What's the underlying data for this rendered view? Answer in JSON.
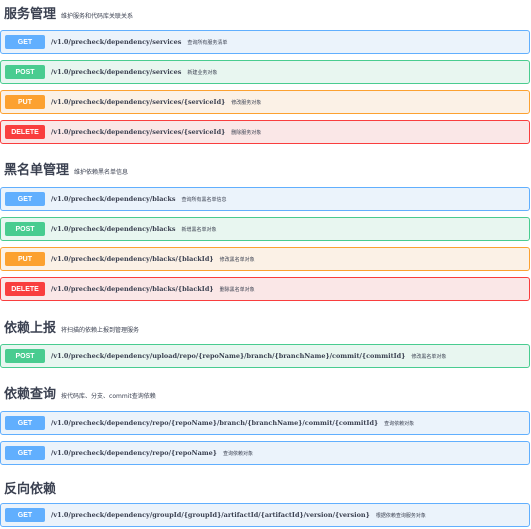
{
  "sections": [
    {
      "title": "服务管理",
      "description": "维护服务和代码库关联关系",
      "operations": [
        {
          "method": "GET",
          "path": "/v1.0/precheck/dependency/services",
          "summary": "查询所有服务清单"
        },
        {
          "method": "POST",
          "path": "/v1.0/precheck/dependency/services",
          "summary": "新建业务对象"
        },
        {
          "method": "PUT",
          "path": "/v1.0/precheck/dependency/services/{serviceId}",
          "summary": "修改服务对象"
        },
        {
          "method": "DELETE",
          "path": "/v1.0/precheck/dependency/services/{serviceId}",
          "summary": "删除服务对象"
        }
      ]
    },
    {
      "title": "黑名单管理",
      "description": "维护依赖黑名单信息",
      "operations": [
        {
          "method": "GET",
          "path": "/v1.0/precheck/dependency/blacks",
          "summary": "查询所有黑名单信息"
        },
        {
          "method": "POST",
          "path": "/v1.0/precheck/dependency/blacks",
          "summary": "新增黑名单对象"
        },
        {
          "method": "PUT",
          "path": "/v1.0/precheck/dependency/blacks/{blackId}",
          "summary": "修改黑名单对象"
        },
        {
          "method": "DELETE",
          "path": "/v1.0/precheck/dependency/blacks/{blackId}",
          "summary": "删除黑名单对象"
        }
      ]
    },
    {
      "title": "依赖上报",
      "description": "将扫描的依赖上报到管理服务",
      "operations": [
        {
          "method": "POST",
          "path": "/v1.0/precheck/dependency/upload/repo/{repoName}/branch/{branchName}/commit/{commitId}",
          "summary": "修改黑名单对象"
        }
      ]
    },
    {
      "title": "依赖查询",
      "description": "按代码库、分支、commit查询依赖",
      "operations": [
        {
          "method": "GET",
          "path": "/v1.0/precheck/dependency/repo/{repoName}/branch/{branchName}/commit/{commitId}",
          "summary": "查询依赖对象"
        },
        {
          "method": "GET",
          "path": "/v1.0/precheck/dependency/repo/{repoName}",
          "summary": "查询依赖对象"
        }
      ]
    },
    {
      "title": "反向依赖",
      "description": "",
      "operations": [
        {
          "method": "GET",
          "path": "/v1.0/precheck/dependency/groupId/{groupId}/artifactId/{artifactId}/version/{version}",
          "summary": "根据依赖查询服务对象"
        }
      ]
    }
  ],
  "colors": {
    "get": "#61affe",
    "post": "#49cc90",
    "put": "#fca130",
    "delete": "#f93e3e",
    "text": "#3b4151"
  }
}
